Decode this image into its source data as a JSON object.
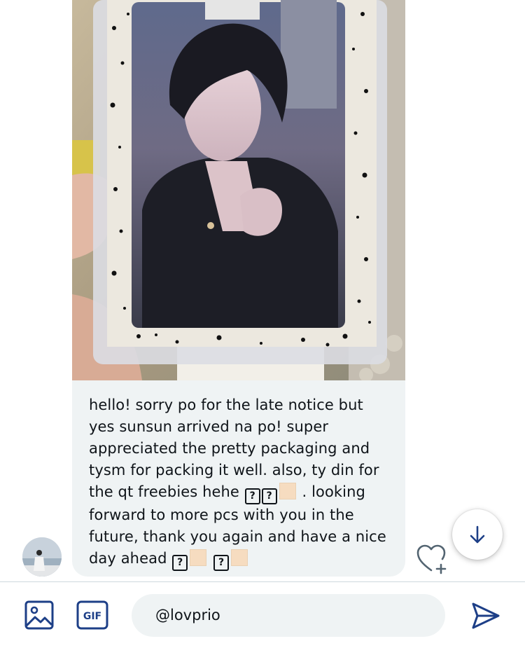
{
  "message": {
    "lines": [
      "hello! sorry po for the late notice but",
      "yes sunsun arrived na po! super",
      "appreciated the pretty packaging and",
      "tysm for packing it well. also, ty din for",
      "the qt freebies hehe",
      ". looking",
      "forward to more pcs with you in the",
      "future, thank you again and have a nice",
      "day ahead"
    ],
    "unknown_glyph": "?"
  },
  "composer": {
    "value": "@lovprio",
    "image_icon": "image-icon",
    "gif_label": "GIF",
    "send_icon": "send-icon"
  },
  "colors": {
    "accent": "#1d3f87",
    "bubble": "#eff3f4",
    "text": "#0f1419",
    "swatch": "#f6dcc0"
  },
  "icons": {
    "scroll_down": "arrow-down-icon",
    "react": "heart-plus-icon",
    "avatar": "avatar"
  }
}
